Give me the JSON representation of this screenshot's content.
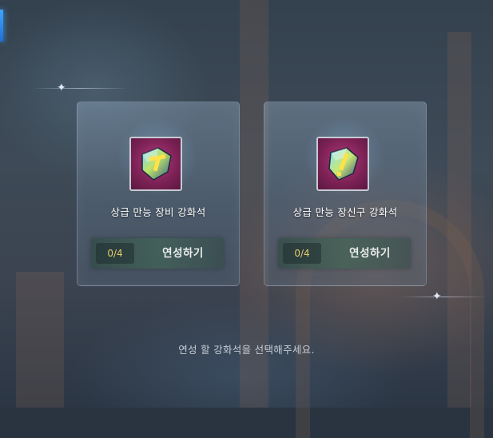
{
  "cards": [
    {
      "name": "상급 만능 장비 강화석",
      "count": "0/4",
      "action_label": "연성하기",
      "icon": "equipment-enhance-stone-icon"
    },
    {
      "name": "상급 만능 장신구 강화석",
      "count": "0/4",
      "action_label": "연성하기",
      "icon": "accessory-enhance-stone-icon"
    }
  ],
  "hint": "연성 할 강화석을 선택해주세요.",
  "colors": {
    "count_text": "#e3c96a",
    "accent_bar": "#3fa6ff",
    "icon_bg": "#7c2155"
  }
}
